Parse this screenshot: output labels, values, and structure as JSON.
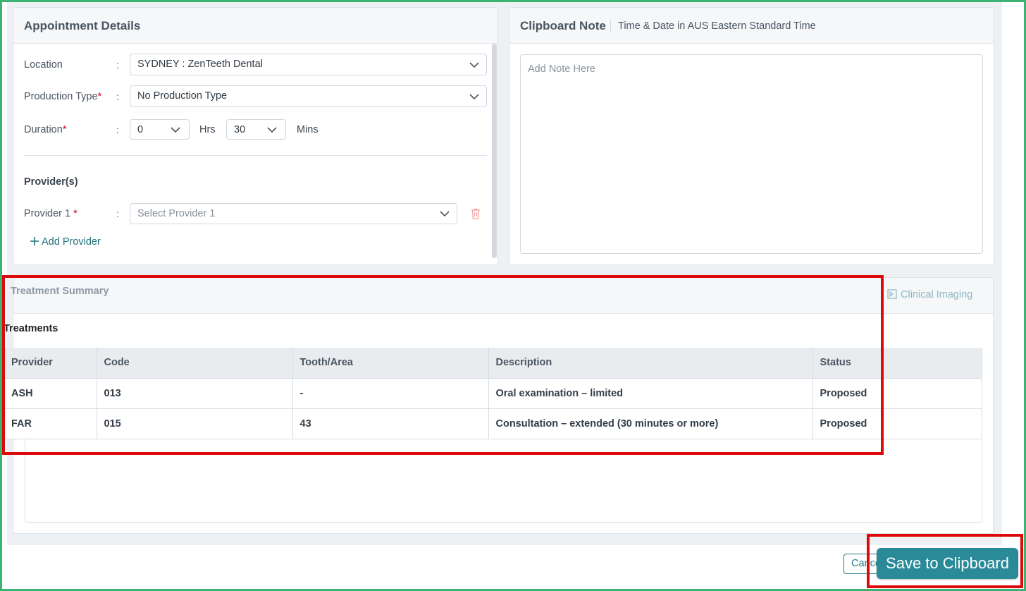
{
  "appointment": {
    "title": "Appointment Details",
    "location_label": "Location",
    "location_value": "SYDNEY : ZenTeeth Dental",
    "production_label": "Production Type",
    "production_value": "No Production Type",
    "duration_label": "Duration",
    "duration_hrs": "0",
    "hrs_unit": "Hrs",
    "duration_mins": "30",
    "mins_unit": "Mins",
    "providers_heading": "Provider(s)",
    "provider1_label": "Provider 1",
    "provider1_placeholder": "Select Provider 1",
    "add_provider": "Add Provider",
    "colon": ":",
    "required_mark": "*"
  },
  "clipboard": {
    "title": "Clipboard Note",
    "subtitle": "Time & Date in AUS Eastern Standard Time",
    "placeholder": "Add Note Here"
  },
  "treatment": {
    "title": "Treatment Summary",
    "clinical_imaging": "Clinical Imaging",
    "treatments_heading": "Treatments",
    "columns": [
      "Provider",
      "Code",
      "Tooth/Area",
      "Description",
      "Status"
    ],
    "rows": [
      [
        "ASH",
        "013",
        "-",
        "Oral examination – limited",
        "Proposed"
      ],
      [
        "FAR",
        "015",
        "43",
        "Consultation – extended (30 minutes or more)",
        "Proposed"
      ]
    ]
  },
  "footer": {
    "cancel_label": "Cancel",
    "save_label": "Save to Clipboard"
  },
  "colors": {
    "accent": "#2a8a98",
    "highlight": "#dc0a0a",
    "frame": "#3cb371"
  }
}
